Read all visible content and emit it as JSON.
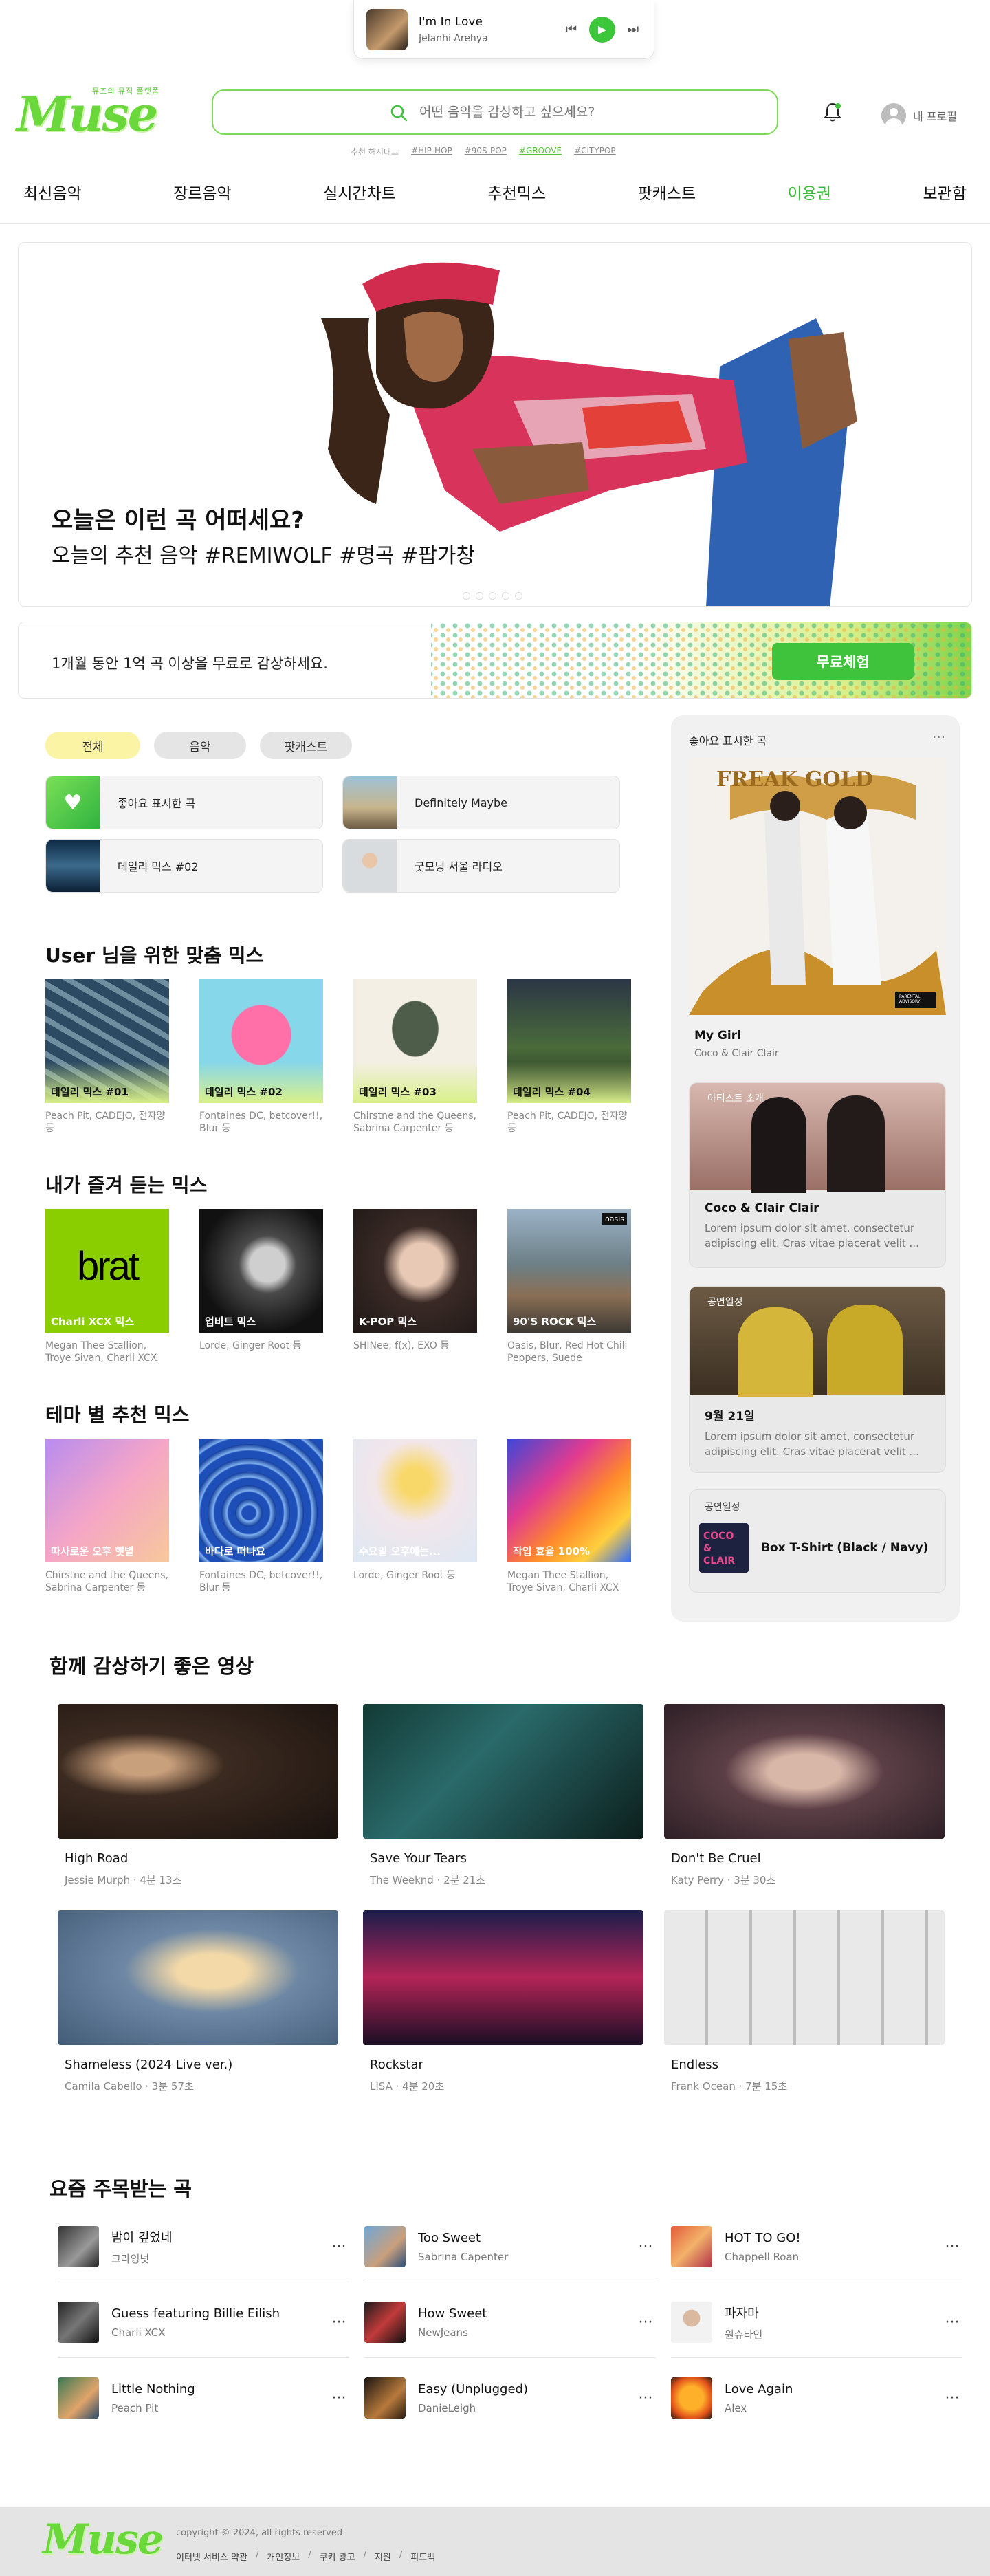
{
  "player": {
    "title": "I'm In Love",
    "artist": "Jelanhi Arehya",
    "prev_icon": "skip-back-icon",
    "play_icon": "play-icon",
    "next_icon": "skip-forward-icon"
  },
  "brand": {
    "name": "Muse",
    "tagline": "뮤즈의 뮤직 플랫폼",
    "accent": "#3fc23c"
  },
  "search": {
    "placeholder": "어떤 음악을 감상하고 싶으세요?",
    "value": ""
  },
  "hashtags": {
    "label": "추천 해시태그",
    "items": [
      "#HIP-HOP",
      "#90S-POP",
      "#GROOVE",
      "#CITYPOP"
    ]
  },
  "profile": {
    "label": "내 프로필"
  },
  "nav": [
    "최신음악",
    "장르음악",
    "실시간차트",
    "추천믹스",
    "팟캐스트",
    "이용권",
    "보관함"
  ],
  "hero": {
    "title": "오늘은 이런 곡 어떠세요?",
    "subtitle": "오늘의 추천 음악 #REMIWOLF #명곡 #팝가창",
    "slides": 5,
    "active_slide": 1
  },
  "promo": {
    "text": "1개월 동안 1억 곡 이상을 무료로 감상하세요.",
    "button": "무료체험"
  },
  "filters": [
    "전체",
    "음악",
    "팟캐스트"
  ],
  "quick": [
    "좋아요 표시한 곡",
    "Definitely Maybe",
    "데일리 믹스 #02",
    "굿모닝 서울 라디오"
  ],
  "mix": {
    "title": "User 님을 위한 맞춤 믹스",
    "items": [
      {
        "cap": "데일리 믹스 #01",
        "sub": "Peach Pit, CADEJO, 전자양 등"
      },
      {
        "cap": "데일리 믹스 #02",
        "sub": "Fontaines DC, betcover!!, Blur 등"
      },
      {
        "cap": "데일리 믹스 #03",
        "sub": "Chirstne and the Queens, Sabrina Carpenter 등"
      },
      {
        "cap": "데일리 믹스 #04",
        "sub": "Peach Pit, CADEJO, 전자양 등"
      }
    ]
  },
  "fav": {
    "title": "내가 즐겨 듣는 믹스",
    "items": [
      {
        "cap": "Charli XCX 믹스",
        "sub": "Megan Thee Stallion, Troye Sivan, Charli XCX",
        "brat": "brat"
      },
      {
        "cap": "업비트 믹스",
        "sub": "Lorde, Ginger Root 등"
      },
      {
        "cap": "K-POP 믹스",
        "sub": "SHINee, f(x), EXO 등"
      },
      {
        "cap": "90'S ROCK 믹스",
        "sub": "Oasis, Blur, Red Hot Chili Peppers, Suede",
        "badge": "oasis"
      }
    ]
  },
  "theme": {
    "title": "테마 별 추천 믹스",
    "items": [
      {
        "cap": "따사로운 오후 햇볕",
        "sub": "Chirstne and the Queens, Sabrina Carpenter 등"
      },
      {
        "cap": "바다로 떠나요",
        "sub": "Fontaines DC, betcover!!, Blur 등"
      },
      {
        "cap": "수요일 오후에는...",
        "sub": "Lorde, Ginger Root 등"
      },
      {
        "cap": "작업 효율 100%",
        "sub": "Megan Thee Stallion, Troye Sivan, Charli XCX"
      }
    ]
  },
  "panel": {
    "header": "좋아요 표시한 곡",
    "song": {
      "title": "My Girl",
      "artist": "Coco & Clair Clair",
      "art_text": "FREAK GOLD",
      "label": "PARENTAL ADVISORY"
    },
    "artist": {
      "over": "아티스트 소개",
      "title": "Coco & Clair Clair",
      "desc": "Lorem ipsum dolor sit amet, consectetur adipiscing elit. Cras vitae placerat velit ..."
    },
    "concert": {
      "over": "공연일정",
      "title": "9월 21일",
      "desc": "Lorem ipsum dolor sit amet, consectetur adipiscing elit. Cras vitae placerat velit ..."
    },
    "merch": {
      "over": "공연일정",
      "title": "Box T-Shirt (Black / Navy)",
      "art_text": "COCO & CLAIR"
    }
  },
  "videos": {
    "title": "함께 감상하기 좋은 영상",
    "items": [
      {
        "title": "High Road",
        "sub": "Jessie Murph · 4분 13초"
      },
      {
        "title": "Save Your Tears",
        "sub": "The Weeknd · 2분 21초"
      },
      {
        "title": "Don't Be Cruel",
        "sub": "Katy Perry · 3분 30초"
      },
      {
        "title": "Shameless (2024 Live ver.)",
        "sub": "Camila Cabello · 3분 57초"
      },
      {
        "title": "Rockstar",
        "sub": "LISA · 4분 20초"
      },
      {
        "title": "Endless",
        "sub": "Frank Ocean · 7분 15초"
      }
    ]
  },
  "trending": {
    "title": "요즘 주목받는 곡",
    "items": [
      {
        "name": "밤이 깊었네",
        "artist": "크라잉넛"
      },
      {
        "name": "Too Sweet",
        "artist": "Sabrina Capenter"
      },
      {
        "name": "HOT TO GO!",
        "artist": "Chappell Roan"
      },
      {
        "name": "Guess featuring Billie Eilish",
        "artist": "Charli XCX"
      },
      {
        "name": "How Sweet",
        "artist": "NewJeans"
      },
      {
        "name": "파자마",
        "artist": "원슈타인"
      },
      {
        "name": "Little Nothing",
        "artist": "Peach Pit"
      },
      {
        "name": "Easy (Unplugged)",
        "artist": "DanieLeigh"
      },
      {
        "name": "Love Again",
        "artist": "Alex"
      }
    ]
  },
  "footer": {
    "copyright": "copyright © 2024, all rights reserved",
    "links": [
      "이터넷 서비스 약관",
      "개인정보",
      "쿠키 광고",
      "지원",
      "피드백"
    ]
  }
}
